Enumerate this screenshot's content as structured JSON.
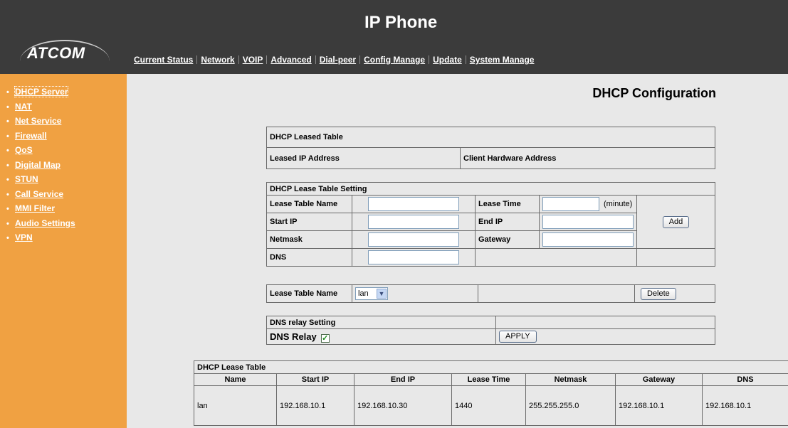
{
  "header": {
    "logo_text": "ATCOM",
    "app_title": "IP Phone",
    "nav": [
      "Current Status",
      "Network",
      "VOIP",
      "Advanced",
      "Dial-peer",
      "Config Manage",
      "Update",
      "System Manage"
    ]
  },
  "sidebar": {
    "bullet": "•",
    "items": [
      "DHCP Server",
      "NAT",
      "Net Service",
      "Firewall",
      "QoS",
      "Digital Map",
      "STUN",
      "Call Service",
      "MMI Filter",
      "Audio Settings",
      "VPN"
    ]
  },
  "page_title": "DHCP Configuration",
  "leased_table": {
    "title": "DHCP Leased Table",
    "col_ip": "Leased IP Address",
    "col_mac": "Client Hardware Address"
  },
  "lease_setting": {
    "title": "DHCP Lease Table Setting",
    "lease_table_name_label": "Lease Table Name",
    "lease_table_name_value": "",
    "lease_time_label": "Lease Time",
    "lease_time_value": "",
    "lease_time_unit": "(minute)",
    "start_ip_label": "Start IP",
    "start_ip_value": "",
    "end_ip_label": "End IP",
    "end_ip_value": "",
    "netmask_label": "Netmask",
    "netmask_value": "",
    "gateway_label": "Gateway",
    "gateway_value": "",
    "dns_label": "DNS",
    "dns_value": "",
    "add_button": "Add"
  },
  "delete_row": {
    "label": "Lease Table Name",
    "selected": "lan",
    "delete_button": "Delete"
  },
  "dns_relay": {
    "title": "DNS relay Setting",
    "label": "DNS Relay",
    "checked_mark": "✓",
    "apply_button": "APPLY"
  },
  "lease_table": {
    "title": "DHCP Lease Table",
    "columns": [
      "Name",
      "Start IP",
      "End IP",
      "Lease Time",
      "Netmask",
      "Gateway",
      "DNS"
    ],
    "rows": [
      [
        "lan",
        "192.168.10.1",
        "192.168.10.30",
        "1440",
        "255.255.255.0",
        "192.168.10.1",
        "192.168.10.1"
      ]
    ]
  },
  "colors": {
    "header_bg": "#3b3b3b",
    "sidebar_bg": "#f0a142",
    "content_bg": "#e8e8e8"
  }
}
